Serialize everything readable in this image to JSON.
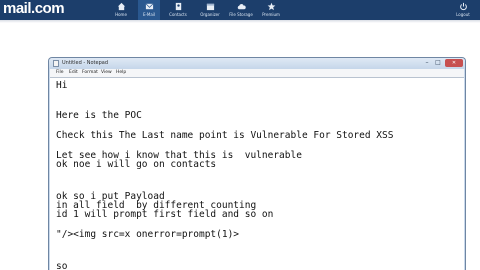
{
  "site": {
    "logo_left": "m",
    "logo_right": "ail.com",
    "nav": [
      {
        "label": "Home",
        "icon": "home-icon"
      },
      {
        "label": "E-Mail",
        "icon": "mail-icon"
      },
      {
        "label": "Contacts",
        "icon": "contacts-icon"
      },
      {
        "label": "Organizer",
        "icon": "calendar-icon"
      },
      {
        "label": "File Storage",
        "icon": "cloud-icon"
      },
      {
        "label": "Premium",
        "icon": "star-icon"
      },
      {
        "label": "Logout",
        "icon": "power-icon"
      }
    ]
  },
  "notepad": {
    "title": "Untitled - Notepad",
    "menu": [
      "File",
      "Edit",
      "Format",
      "View",
      "Help"
    ],
    "lines": [
      "Hi",
      "Here is the POC",
      "Check this The Last name point is Vulnerable For Stored XSS",
      "Let see how i know that this is  vulnerable",
      "ok noe i will go on contacts",
      "ok so i put Payload",
      "in all field  by different counting",
      "id 1 will prompt first field and so on",
      "\"/><img src=x onerror=prompt(1)>",
      "so"
    ]
  },
  "colors": {
    "topbar": "#1c3e6b",
    "active_nav": "#2a588f",
    "window_frame": "#c9d9ec"
  }
}
